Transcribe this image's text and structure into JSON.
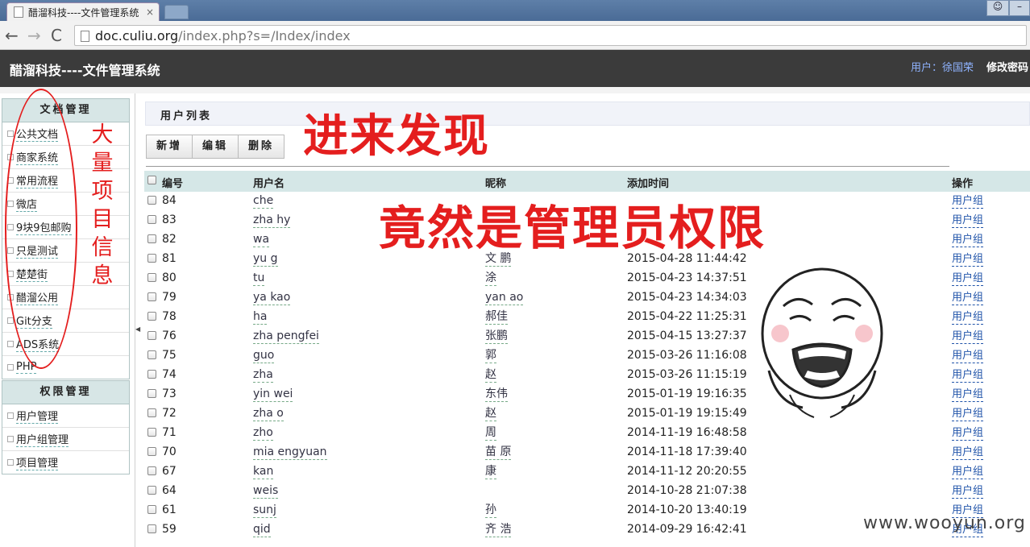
{
  "browser": {
    "tab_title": "醋溜科技----文件管理系统",
    "tab_close": "×",
    "url_host": "doc.culiu.org",
    "url_path": "/index.php?s=/Index/index",
    "back": "←",
    "forward": "→",
    "reload": "C"
  },
  "header": {
    "title": "醋溜科技----文件管理系统",
    "user": "用户：徐国荣",
    "change_password": "修改密码"
  },
  "sidebar": {
    "docs_title": "文档管理",
    "docs_items": [
      "公共文档",
      "商家系统",
      "常用流程",
      "微店",
      "9块9包邮购",
      "只是测试",
      "楚楚街",
      "醋溜公用",
      "Git分支",
      "ADS系统",
      "PHP"
    ],
    "perm_title": "权限管理",
    "perm_items": [
      "用户管理",
      "用户组管理",
      "项目管理"
    ]
  },
  "main": {
    "panel_title": "用户列表",
    "toolbar": {
      "add": "新增",
      "edit": "编辑",
      "delete": "删除"
    },
    "columns": {
      "id": "编号",
      "name": "用户名",
      "nick": "昵称",
      "time": "添加时间",
      "op": "操作"
    },
    "rows": [
      {
        "id": "84",
        "name": "che",
        "nick": "",
        "time": "",
        "op": "用户组"
      },
      {
        "id": "83",
        "name": "zha   hy",
        "nick": "",
        "time": "",
        "op": "用户组"
      },
      {
        "id": "82",
        "name": "wa",
        "nick": "",
        "time": "",
        "op": "用户组"
      },
      {
        "id": "81",
        "name": "yu   g",
        "nick": "文   鹏",
        "time": "2015-04-28 11:44:42",
        "op": "用户组"
      },
      {
        "id": "80",
        "name": "tu",
        "nick": "涂",
        "time": "2015-04-23 14:37:51",
        "op": "用户组"
      },
      {
        "id": "79",
        "name": "ya   kao",
        "nick": "yan   ao",
        "time": "2015-04-23 14:34:03",
        "op": "用户组"
      },
      {
        "id": "78",
        "name": "ha",
        "nick": "郝佳",
        "time": "2015-04-22 11:25:31",
        "op": "用户组"
      },
      {
        "id": "76",
        "name": "zha   pengfei",
        "nick": "张鹏",
        "time": "2015-04-15 13:27:37",
        "op": "用户组"
      },
      {
        "id": "75",
        "name": "guo",
        "nick": "郭",
        "time": "2015-03-26 11:16:08",
        "op": "用户组"
      },
      {
        "id": "74",
        "name": "zha",
        "nick": "赵",
        "time": "2015-03-26 11:15:19",
        "op": "用户组"
      },
      {
        "id": "73",
        "name": "yin   wei",
        "nick": "   东伟",
        "time": "2015-01-19 19:16:35",
        "op": "用户组"
      },
      {
        "id": "72",
        "name": "zha   o",
        "nick": "赵",
        "time": "2015-01-19 19:15:49",
        "op": "用户组"
      },
      {
        "id": "71",
        "name": "zho",
        "nick": "周",
        "time": "2014-11-19 16:48:58",
        "op": "用户组"
      },
      {
        "id": "70",
        "name": "mia   engyuan",
        "nick": "苗   原",
        "time": "2014-11-18 17:39:40",
        "op": "用户组"
      },
      {
        "id": "67",
        "name": "kan",
        "nick": "康",
        "time": "2014-11-12 20:20:55",
        "op": "用户组"
      },
      {
        "id": "64",
        "name": "weis",
        "nick": "    ",
        "time": "2014-10-28 21:07:38",
        "op": "用户组"
      },
      {
        "id": "61",
        "name": "sunj",
        "nick": "孙",
        "time": "2014-10-20 13:40:19",
        "op": "用户组"
      },
      {
        "id": "59",
        "name": "qid",
        "nick": "齐   浩",
        "time": "2014-09-29 16:42:41",
        "op": "用户组"
      }
    ]
  },
  "annotations": {
    "a1": "进来发现",
    "a2": "竟然是管理员权限",
    "vertical": [
      "大",
      "量",
      "项",
      "目",
      "信",
      "息"
    ]
  },
  "watermark": "www.wooyun.org"
}
